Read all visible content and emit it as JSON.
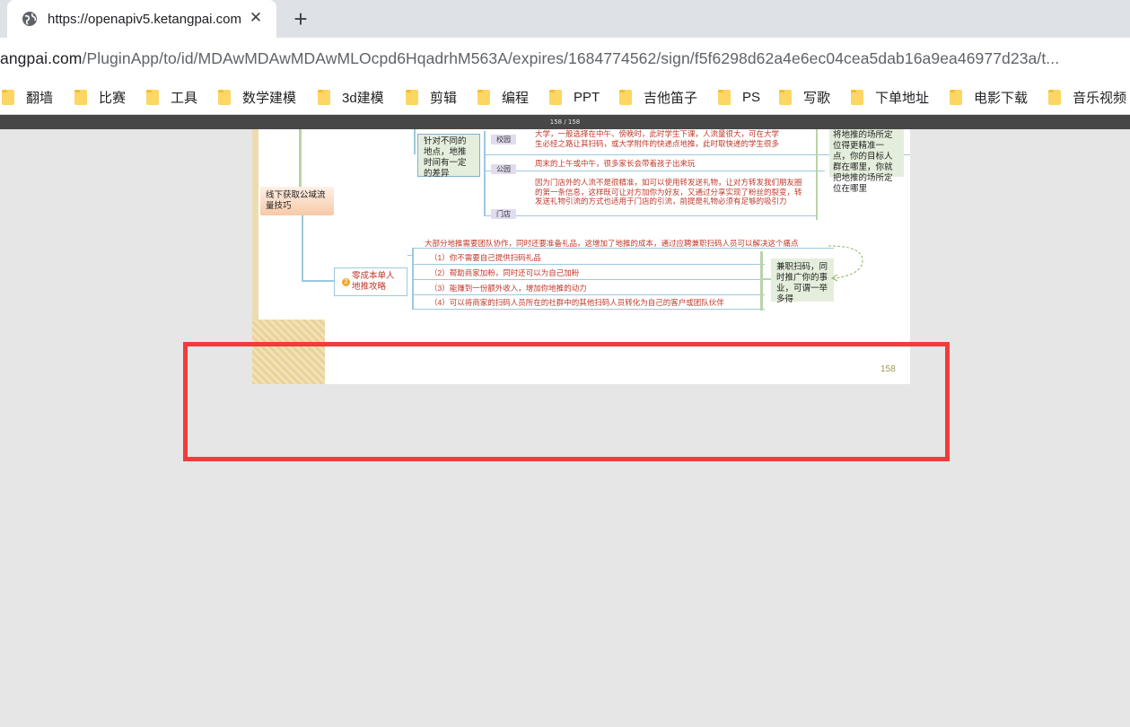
{
  "tab": {
    "title": "https://openapiv5.ketangpai.com",
    "icon": "globe-icon",
    "close_glyph": "✕",
    "new_tab_glyph": "+"
  },
  "address": {
    "host": "angpai.com",
    "path": "/PluginApp/to/id/MDAwMDAwMDAwMLOcpd6HqadrhM563A/expires/1684774562/sign/f5f6298d62a4e6ec04cea5dab16a9ea46977d23a/t..."
  },
  "bookmarks": [
    {
      "label": "翻墙"
    },
    {
      "label": "比赛"
    },
    {
      "label": "工具"
    },
    {
      "label": "数学建模"
    },
    {
      "label": "3d建模"
    },
    {
      "label": "剪辑"
    },
    {
      "label": "编程"
    },
    {
      "label": "PPT"
    },
    {
      "label": "吉他笛子"
    },
    {
      "label": "PS"
    },
    {
      "label": "写歌"
    },
    {
      "label": "下单地址"
    },
    {
      "label": "电影下载"
    },
    {
      "label": "音乐视频"
    }
  ],
  "pdf": {
    "page_indicator": "158 / 158",
    "page_number": "158",
    "root_node": "线下获取公域流量技巧",
    "diff_node": "针对不同的地点，地推时间有一定的差异",
    "tags": {
      "campus": "校园",
      "park": "公园",
      "store": "门店"
    },
    "campus_text": "大学，一般选择在中午、傍晚时，此时学生下课，人流量很大，可在大学生必经之路让其扫码，或大学附件的快递点地推，此时取快递的学生很多",
    "park_text": "周末的上午或中午，很多家长会带着孩子出来玩",
    "store_text": "因为门店外的人流不是很精准，如可以使用转发送礼物，让对方转发我们朋友圈的第一条信息，这样既可让对方加你为好友，又通过分享实现了粉丝的裂变，转发送礼物引流的方式也适用于门店的引流，前提是礼物必须有足够的吸引力",
    "right_note": "将地推的场所定位得更精准一点，你的目标人群在哪里，你就把地推的场所定位在哪里",
    "zero_node_num": "2",
    "zero_node": "零成本单人地推攻略",
    "team_text": "大部分地推需要团队协作，同时还要准备礼品，这增加了地推的成本，通过应聘兼职扫码人员可以解决这个痛点",
    "items": [
      "（1）你不需要自己提供扫码礼品",
      "（2）帮助商家加粉，同时还可以为自己加粉",
      "（3）能赚到一份额外收入，增加你地推的动力",
      "（4）可以将商家的扫码人员所在的社群中的其他扫码人员转化为自己的客户或团队伙伴"
    ],
    "scan_note": "兼职扫码，同时推广你的事业，可谓一举多得"
  },
  "colors": {
    "highlight": "#f23b3b",
    "tabstrip": "#dee1e6",
    "viewer_bg": "#e6e6e6"
  }
}
